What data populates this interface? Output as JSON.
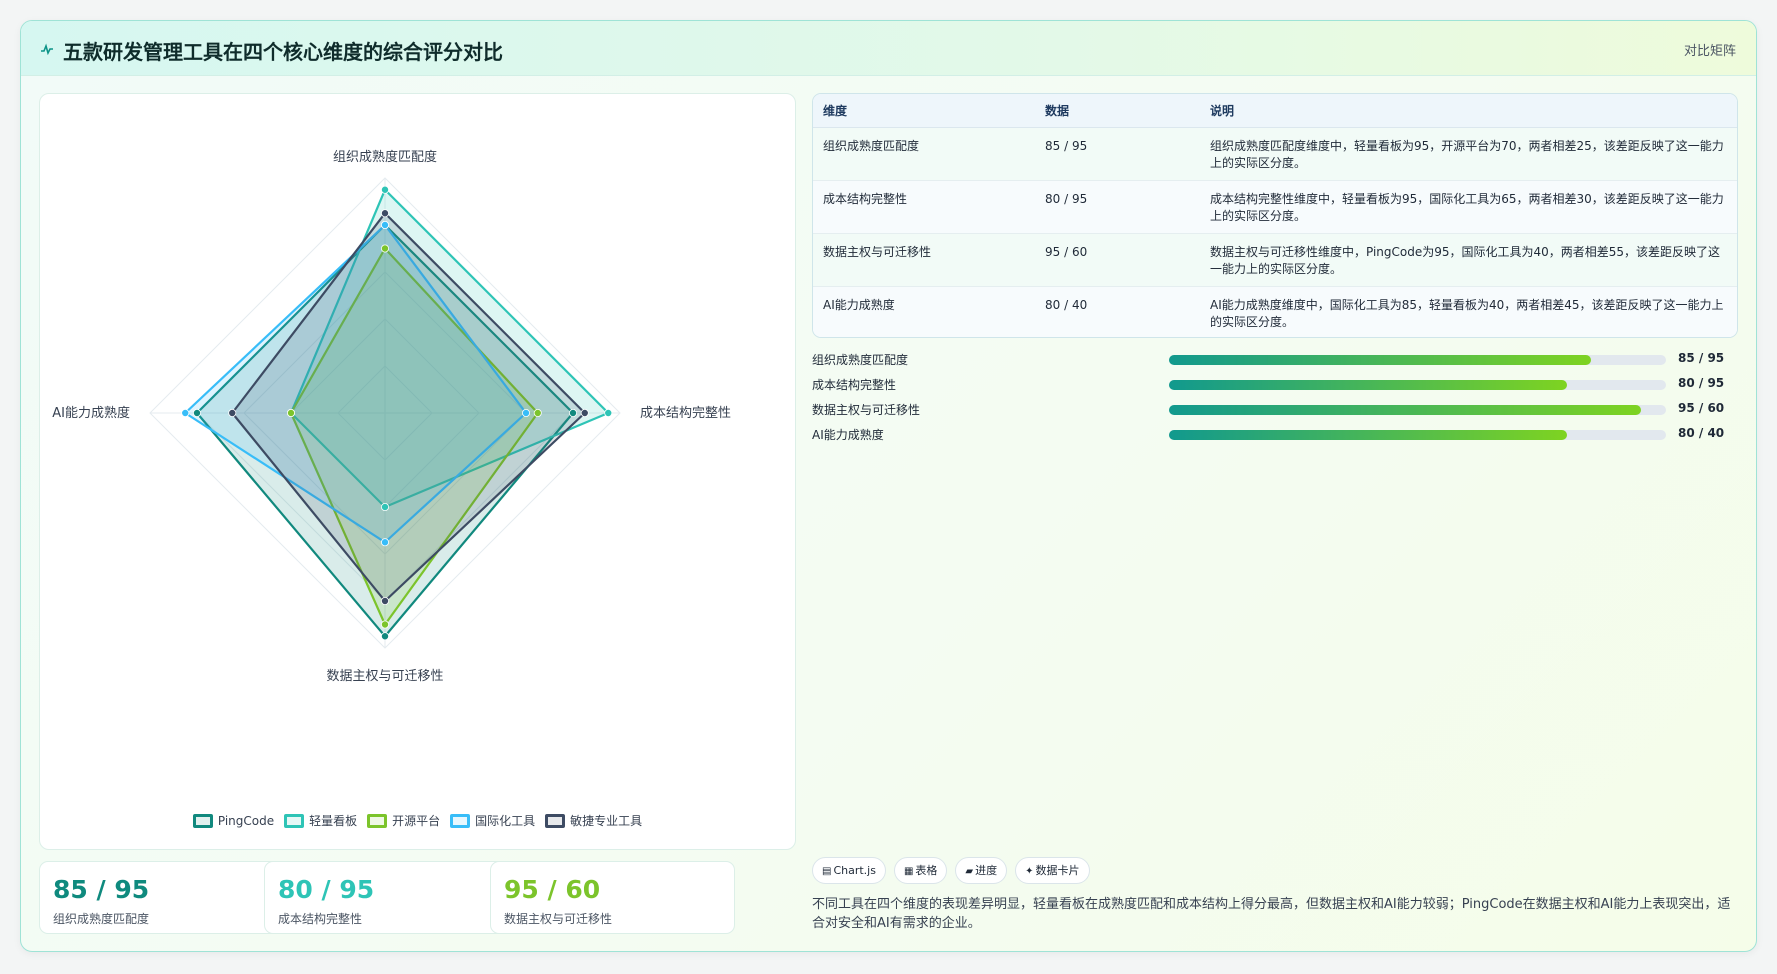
{
  "header": {
    "title": "五款研发管理工具在四个核心维度的综合评分对比",
    "title_icon": "pulse-icon",
    "right_label": "对比矩阵"
  },
  "colors": {
    "accent": "#0d9488",
    "value_teal_dark": "#0f8a7e",
    "value_teal": "#2ec4b6",
    "value_green": "#7cc42b"
  },
  "chart_data": {
    "type": "radar",
    "title": "",
    "axes": [
      "组织成熟度匹配度",
      "成本结构完整性",
      "数据主权与可迁移性",
      "AI能力成熟度"
    ],
    "range": [
      0,
      100
    ],
    "grid": true,
    "legend_position": "bottom",
    "series": [
      {
        "name": "PingCode",
        "values": [
          80,
          80,
          95,
          80
        ],
        "color": "#11897e"
      },
      {
        "name": "轻量看板",
        "values": [
          95,
          95,
          40,
          40
        ],
        "color": "#2ec4b6"
      },
      {
        "name": "开源平台",
        "values": [
          70,
          65,
          90,
          40
        ],
        "color": "#7cc42b"
      },
      {
        "name": "国际化工具",
        "values": [
          80,
          60,
          55,
          85
        ],
        "color": "#38bdf8"
      },
      {
        "name": "敏捷专业工具",
        "values": [
          85,
          85,
          80,
          65
        ],
        "color": "#3d4b63"
      }
    ]
  },
  "table": {
    "headers": [
      "维度",
      "数据",
      "说明"
    ],
    "rows": [
      {
        "dimension": "组织成熟度匹配度",
        "data": "85 / 95",
        "note": "组织成熟度匹配度维度中，轻量看板为95，开源平台为70，两者相差25，该差距反映了这一能力上的实际区分度。"
      },
      {
        "dimension": "成本结构完整性",
        "data": "80 / 95",
        "note": "成本结构完整性维度中，轻量看板为95，国际化工具为65，两者相差30，该差距反映了这一能力上的实际区分度。"
      },
      {
        "dimension": "数据主权与可迁移性",
        "data": "95 / 60",
        "note": "数据主权与可迁移性维度中，PingCode为95，国际化工具为40，两者相差55，该差距反映了这一能力上的实际区分度。"
      },
      {
        "dimension": "AI能力成熟度",
        "data": "80 / 40",
        "note": "AI能力成熟度维度中，国际化工具为85，轻量看板为40，两者相差45，该差距反映了这一能力上的实际区分度。"
      }
    ]
  },
  "progress": [
    {
      "label": "组织成熟度匹配度",
      "value_text": "85 / 95",
      "fraction": 0.85
    },
    {
      "label": "成本结构完整性",
      "value_text": "80 / 95",
      "fraction": 0.8
    },
    {
      "label": "数据主权与可迁移性",
      "value_text": "95 / 60",
      "fraction": 0.95
    },
    {
      "label": "AI能力成熟度",
      "value_text": "80 / 40",
      "fraction": 0.8
    }
  ],
  "stats": [
    {
      "value": "85 / 95",
      "label": "组织成熟度匹配度"
    },
    {
      "value": "80 / 95",
      "label": "成本结构完整性"
    },
    {
      "value": "95 / 60",
      "label": "数据主权与可迁移性"
    }
  ],
  "chips": [
    {
      "icon": "chart-icon",
      "glyph": "▤",
      "label": "Chart.js"
    },
    {
      "icon": "table-icon",
      "glyph": "▦",
      "label": "表格"
    },
    {
      "icon": "progress-icon",
      "glyph": "▰",
      "label": "进度"
    },
    {
      "icon": "card-icon",
      "glyph": "✦",
      "label": "数据卡片"
    }
  ],
  "summary": "不同工具在四个维度的表现差异明显，轻量看板在成熟度匹配和成本结构上得分最高，但数据主权和AI能力较弱；PingCode在数据主权和AI能力上表现突出，适合对安全和AI有需求的企业。"
}
